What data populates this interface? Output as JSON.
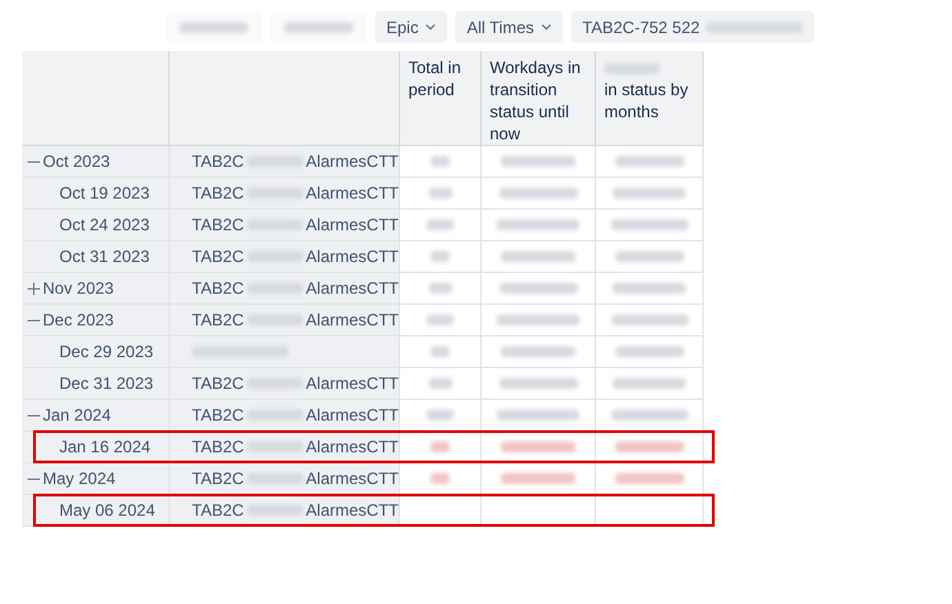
{
  "toolbar": {
    "filters": [
      {
        "kind": "blurred"
      },
      {
        "kind": "blurred"
      },
      {
        "kind": "dropdown",
        "label": "Epic"
      },
      {
        "kind": "dropdown",
        "label": "All Times"
      },
      {
        "kind": "text",
        "label": "TAB2C-752 522"
      }
    ]
  },
  "table": {
    "columns": [
      {
        "label": "Total in period"
      },
      {
        "label": "Workdays in transition status until now"
      },
      {
        "label": "in status by months",
        "blurred_prefix": true
      }
    ],
    "rows": [
      {
        "kind": "group",
        "expanded": true,
        "label": "Oct 2023",
        "issue_start": "TAB2C",
        "issue_end": "AlarmesCTT",
        "values_blurred": true,
        "flagged": false,
        "highlight": false
      },
      {
        "kind": "day",
        "label": "Oct 19 2023",
        "issue_start": "TAB2C",
        "issue_end": "AlarmesCTT",
        "values_blurred": true,
        "flagged": false,
        "highlight": false
      },
      {
        "kind": "day",
        "label": "Oct 24 2023",
        "issue_start": "TAB2C",
        "issue_end": "AlarmesCTT",
        "values_blurred": true,
        "flagged": false,
        "highlight": false
      },
      {
        "kind": "day",
        "label": "Oct 31 2023",
        "issue_start": "TAB2C",
        "issue_end": "AlarmesCTT",
        "values_blurred": true,
        "flagged": false,
        "highlight": false
      },
      {
        "kind": "group",
        "expanded": false,
        "label": "Nov 2023",
        "issue_start": "TAB2C",
        "issue_end": "AlarmesCTT",
        "values_blurred": true,
        "flagged": false,
        "highlight": false
      },
      {
        "kind": "group",
        "expanded": true,
        "label": "Dec 2023",
        "issue_start": "TAB2C",
        "issue_end": "AlarmesCTT",
        "values_blurred": true,
        "flagged": false,
        "highlight": false
      },
      {
        "kind": "day",
        "label": "Dec 29 2023",
        "values_blurred": true,
        "flagged": false,
        "highlight": false
      },
      {
        "kind": "day",
        "label": "Dec 31 2023",
        "issue_start": "TAB2C",
        "issue_end": "AlarmesCTT",
        "values_blurred": true,
        "flagged": false,
        "highlight": false
      },
      {
        "kind": "group",
        "expanded": true,
        "label": "Jan 2024",
        "issue_start": "TAB2C",
        "issue_end": "AlarmesCTT",
        "values_blurred": true,
        "flagged": false,
        "highlight": false
      },
      {
        "kind": "day",
        "label": "Jan 16 2024",
        "issue_start": "TAB2C",
        "issue_end": "AlarmesCTT",
        "values_blurred": true,
        "flagged": true,
        "highlight": true
      },
      {
        "kind": "group",
        "expanded": true,
        "label": "May 2024",
        "issue_start": "TAB2C",
        "issue_end": "AlarmesCTT",
        "values_blurred": true,
        "flagged": true,
        "highlight": false
      },
      {
        "kind": "day",
        "label": "May 06 2024",
        "issue_start": "TAB2C",
        "issue_end": "AlarmesCTT",
        "values_blurred": false,
        "highlight": true
      }
    ]
  }
}
